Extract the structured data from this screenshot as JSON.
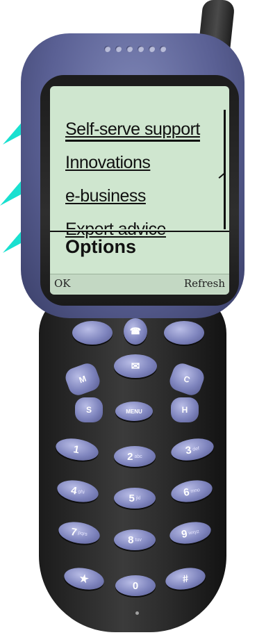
{
  "screen": {
    "menu_items": [
      "Self-serve support",
      "Innovations",
      "e-business",
      "Expert advice"
    ],
    "options_label": "Options",
    "softkey_left": "OK",
    "softkey_right": "Refresh"
  },
  "keypad": {
    "menu_key": "MENU",
    "m_key": "M",
    "s_key": "S",
    "c_key": "C",
    "h_key": "H",
    "digits": [
      {
        "n": "1",
        "s": ""
      },
      {
        "n": "2",
        "s": "abc"
      },
      {
        "n": "3",
        "s": "def"
      },
      {
        "n": "4",
        "s": "ghi"
      },
      {
        "n": "5",
        "s": "jkl"
      },
      {
        "n": "6",
        "s": "mno"
      },
      {
        "n": "7",
        "s": "pqrs"
      },
      {
        "n": "8",
        "s": "tuv"
      },
      {
        "n": "9",
        "s": "wxyz"
      },
      {
        "n": "★",
        "s": ""
      },
      {
        "n": "0",
        "s": ""
      },
      {
        "n": "#",
        "s": ""
      }
    ]
  },
  "colors": {
    "callout_arrows": "#19e0d0",
    "screen_background": "#cfe6cf",
    "phone_face": "#5a6094"
  }
}
